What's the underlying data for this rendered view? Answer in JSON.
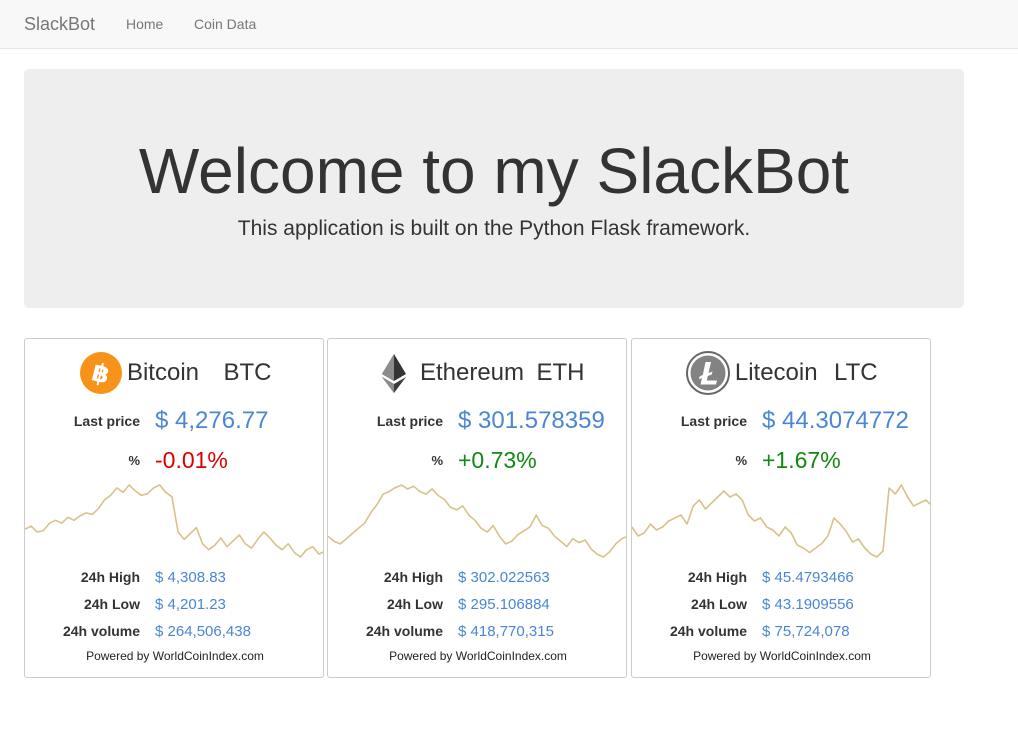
{
  "navbar": {
    "brand": "SlackBot",
    "links": [
      "Home",
      "Coin Data"
    ]
  },
  "jumbotron": {
    "title": "Welcome to my SlackBot",
    "subtitle": "This application is built on the Python Flask framework."
  },
  "labels": {
    "last_price": "Last price",
    "pct": "%",
    "high": "24h High",
    "low": "24h Low",
    "volume": "24h volume",
    "powered": "Powered by WorldCoinIndex.com"
  },
  "colors": {
    "value_blue": "#4a86d4",
    "negative": "#dd0000",
    "positive": "#118811",
    "sparkline": "#d9c28a"
  },
  "coins": [
    {
      "name": "Bitcoin",
      "symbol": "BTC",
      "icon": "bitcoin-icon",
      "last_price": "$ 4,276.77",
      "change": "-0.01%",
      "trend": "negative",
      "high": "$ 4,308.83",
      "low": "$ 4,201.23",
      "volume": "$ 264,506,438",
      "sparkline": [
        32,
        34,
        30,
        31,
        36,
        38,
        36,
        40,
        38,
        41,
        43,
        42,
        46,
        52,
        55,
        60,
        57,
        62,
        58,
        55,
        56,
        60,
        62,
        57,
        54,
        30,
        25,
        29,
        33,
        22,
        18,
        21,
        26,
        20,
        24,
        28,
        22,
        19,
        25,
        30,
        26,
        21,
        18,
        22,
        16,
        13,
        18,
        20,
        15,
        17
      ]
    },
    {
      "name": "Ethereum",
      "symbol": "ETH",
      "icon": "ethereum-icon",
      "last_price": "$ 301.578359",
      "change": "+0.73%",
      "trend": "positive",
      "high": "$ 302.022563",
      "low": "$ 295.106884",
      "volume": "$ 418,770,315",
      "sparkline": [
        24,
        20,
        18,
        22,
        26,
        30,
        34,
        42,
        48,
        56,
        58,
        61,
        63,
        60,
        62,
        58,
        56,
        60,
        55,
        52,
        46,
        44,
        47,
        40,
        36,
        30,
        27,
        32,
        24,
        18,
        20,
        25,
        28,
        31,
        40,
        32,
        30,
        24,
        20,
        16,
        22,
        19,
        21,
        14,
        10,
        8,
        12,
        18,
        22,
        24
      ]
    },
    {
      "name": "Litecoin",
      "symbol": "LTC",
      "icon": "litecoin-icon",
      "last_price": "$ 44.3074772",
      "change": "+1.67%",
      "trend": "positive",
      "high": "$ 45.4793466",
      "low": "$ 43.1909556",
      "volume": "$ 75,724,078",
      "sparkline": [
        36,
        30,
        32,
        38,
        34,
        36,
        40,
        42,
        44,
        38,
        50,
        54,
        48,
        52,
        56,
        60,
        56,
        58,
        54,
        44,
        40,
        42,
        36,
        34,
        30,
        36,
        32,
        24,
        22,
        19,
        22,
        25,
        30,
        42,
        38,
        33,
        26,
        28,
        22,
        18,
        16,
        20,
        62,
        58,
        64,
        56,
        50,
        52,
        54,
        50
      ]
    }
  ]
}
